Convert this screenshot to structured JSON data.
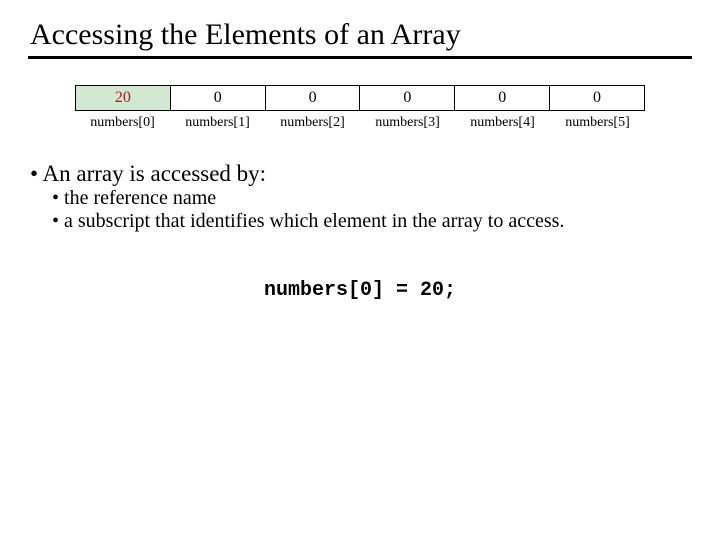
{
  "title": "Accessing the Elements of an Array",
  "array": {
    "cells": [
      {
        "value": "20",
        "highlight": true
      },
      {
        "value": "0",
        "highlight": false
      },
      {
        "value": "0",
        "highlight": false
      },
      {
        "value": "0",
        "highlight": false
      },
      {
        "value": "0",
        "highlight": false
      },
      {
        "value": "0",
        "highlight": false
      }
    ],
    "labels": [
      "numbers[0]",
      "numbers[1]",
      "numbers[2]",
      "numbers[3]",
      "numbers[4]",
      "numbers[5]"
    ]
  },
  "bullets": {
    "lead": "An array is accessed by:",
    "sub1": "the reference name",
    "sub2": "a subscript that identifies which element in the array to access."
  },
  "code_line": "numbers[0] = 20;"
}
